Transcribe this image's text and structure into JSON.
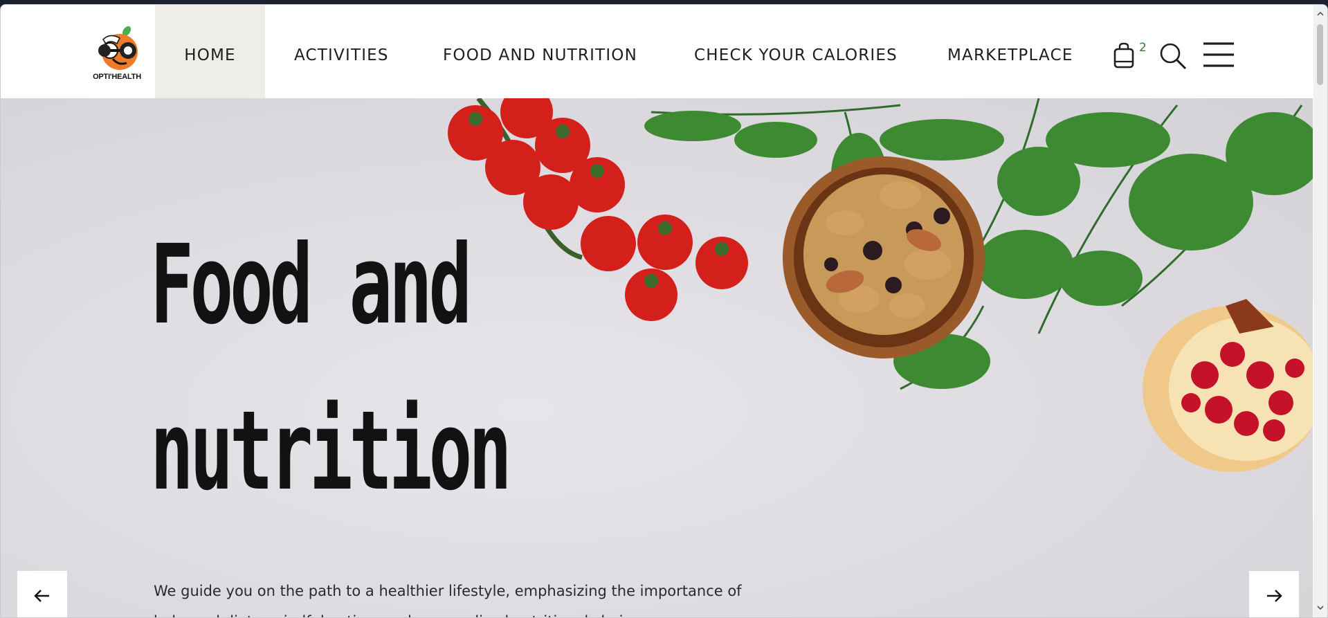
{
  "brand": {
    "logo_text": "OPTI'HEALTH",
    "accent": "#ee7b2b",
    "leaf": "#4caf50"
  },
  "nav": {
    "items": [
      {
        "label": "HOME",
        "active": true
      },
      {
        "label": "ACTIVITIES",
        "active": false
      },
      {
        "label": "FOOD AND NUTRITION",
        "active": false
      },
      {
        "label": "CHECK YOUR CALORIES",
        "active": false
      },
      {
        "label": "MARKETPLACE",
        "active": false
      }
    ],
    "cart_count": "2",
    "icons": [
      "shopping-bag-icon",
      "search-icon",
      "hamburger-menu-icon"
    ]
  },
  "hero": {
    "title_line1": "Food and",
    "title_line2": "nutrition",
    "description": "We guide you on the path to a healthier lifestyle, emphasizing the importance of balanced diets, mindful eating, and personalized nutritional choices.",
    "prev_icon": "arrow-left-icon",
    "next_icon": "arrow-right-icon"
  },
  "colors": {
    "active_nav_bg": "#efedea",
    "text": "#1e1e1e",
    "cart_count": "#2e7d32"
  }
}
